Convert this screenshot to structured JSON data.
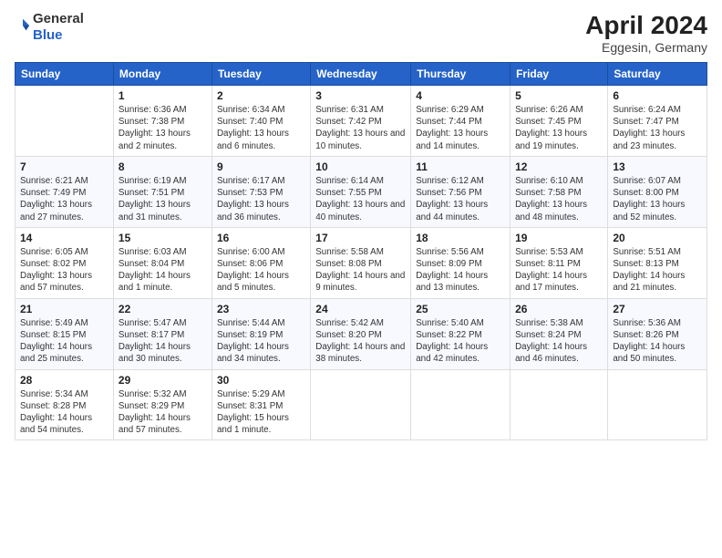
{
  "header": {
    "logo_general": "General",
    "logo_blue": "Blue",
    "month_year": "April 2024",
    "location": "Eggesin, Germany"
  },
  "weekdays": [
    "Sunday",
    "Monday",
    "Tuesday",
    "Wednesday",
    "Thursday",
    "Friday",
    "Saturday"
  ],
  "weeks": [
    [
      {
        "day": "",
        "sunrise": "",
        "sunset": "",
        "daylight": ""
      },
      {
        "day": "1",
        "sunrise": "Sunrise: 6:36 AM",
        "sunset": "Sunset: 7:38 PM",
        "daylight": "Daylight: 13 hours and 2 minutes."
      },
      {
        "day": "2",
        "sunrise": "Sunrise: 6:34 AM",
        "sunset": "Sunset: 7:40 PM",
        "daylight": "Daylight: 13 hours and 6 minutes."
      },
      {
        "day": "3",
        "sunrise": "Sunrise: 6:31 AM",
        "sunset": "Sunset: 7:42 PM",
        "daylight": "Daylight: 13 hours and 10 minutes."
      },
      {
        "day": "4",
        "sunrise": "Sunrise: 6:29 AM",
        "sunset": "Sunset: 7:44 PM",
        "daylight": "Daylight: 13 hours and 14 minutes."
      },
      {
        "day": "5",
        "sunrise": "Sunrise: 6:26 AM",
        "sunset": "Sunset: 7:45 PM",
        "daylight": "Daylight: 13 hours and 19 minutes."
      },
      {
        "day": "6",
        "sunrise": "Sunrise: 6:24 AM",
        "sunset": "Sunset: 7:47 PM",
        "daylight": "Daylight: 13 hours and 23 minutes."
      }
    ],
    [
      {
        "day": "7",
        "sunrise": "Sunrise: 6:21 AM",
        "sunset": "Sunset: 7:49 PM",
        "daylight": "Daylight: 13 hours and 27 minutes."
      },
      {
        "day": "8",
        "sunrise": "Sunrise: 6:19 AM",
        "sunset": "Sunset: 7:51 PM",
        "daylight": "Daylight: 13 hours and 31 minutes."
      },
      {
        "day": "9",
        "sunrise": "Sunrise: 6:17 AM",
        "sunset": "Sunset: 7:53 PM",
        "daylight": "Daylight: 13 hours and 36 minutes."
      },
      {
        "day": "10",
        "sunrise": "Sunrise: 6:14 AM",
        "sunset": "Sunset: 7:55 PM",
        "daylight": "Daylight: 13 hours and 40 minutes."
      },
      {
        "day": "11",
        "sunrise": "Sunrise: 6:12 AM",
        "sunset": "Sunset: 7:56 PM",
        "daylight": "Daylight: 13 hours and 44 minutes."
      },
      {
        "day": "12",
        "sunrise": "Sunrise: 6:10 AM",
        "sunset": "Sunset: 7:58 PM",
        "daylight": "Daylight: 13 hours and 48 minutes."
      },
      {
        "day": "13",
        "sunrise": "Sunrise: 6:07 AM",
        "sunset": "Sunset: 8:00 PM",
        "daylight": "Daylight: 13 hours and 52 minutes."
      }
    ],
    [
      {
        "day": "14",
        "sunrise": "Sunrise: 6:05 AM",
        "sunset": "Sunset: 8:02 PM",
        "daylight": "Daylight: 13 hours and 57 minutes."
      },
      {
        "day": "15",
        "sunrise": "Sunrise: 6:03 AM",
        "sunset": "Sunset: 8:04 PM",
        "daylight": "Daylight: 14 hours and 1 minute."
      },
      {
        "day": "16",
        "sunrise": "Sunrise: 6:00 AM",
        "sunset": "Sunset: 8:06 PM",
        "daylight": "Daylight: 14 hours and 5 minutes."
      },
      {
        "day": "17",
        "sunrise": "Sunrise: 5:58 AM",
        "sunset": "Sunset: 8:08 PM",
        "daylight": "Daylight: 14 hours and 9 minutes."
      },
      {
        "day": "18",
        "sunrise": "Sunrise: 5:56 AM",
        "sunset": "Sunset: 8:09 PM",
        "daylight": "Daylight: 14 hours and 13 minutes."
      },
      {
        "day": "19",
        "sunrise": "Sunrise: 5:53 AM",
        "sunset": "Sunset: 8:11 PM",
        "daylight": "Daylight: 14 hours and 17 minutes."
      },
      {
        "day": "20",
        "sunrise": "Sunrise: 5:51 AM",
        "sunset": "Sunset: 8:13 PM",
        "daylight": "Daylight: 14 hours and 21 minutes."
      }
    ],
    [
      {
        "day": "21",
        "sunrise": "Sunrise: 5:49 AM",
        "sunset": "Sunset: 8:15 PM",
        "daylight": "Daylight: 14 hours and 25 minutes."
      },
      {
        "day": "22",
        "sunrise": "Sunrise: 5:47 AM",
        "sunset": "Sunset: 8:17 PM",
        "daylight": "Daylight: 14 hours and 30 minutes."
      },
      {
        "day": "23",
        "sunrise": "Sunrise: 5:44 AM",
        "sunset": "Sunset: 8:19 PM",
        "daylight": "Daylight: 14 hours and 34 minutes."
      },
      {
        "day": "24",
        "sunrise": "Sunrise: 5:42 AM",
        "sunset": "Sunset: 8:20 PM",
        "daylight": "Daylight: 14 hours and 38 minutes."
      },
      {
        "day": "25",
        "sunrise": "Sunrise: 5:40 AM",
        "sunset": "Sunset: 8:22 PM",
        "daylight": "Daylight: 14 hours and 42 minutes."
      },
      {
        "day": "26",
        "sunrise": "Sunrise: 5:38 AM",
        "sunset": "Sunset: 8:24 PM",
        "daylight": "Daylight: 14 hours and 46 minutes."
      },
      {
        "day": "27",
        "sunrise": "Sunrise: 5:36 AM",
        "sunset": "Sunset: 8:26 PM",
        "daylight": "Daylight: 14 hours and 50 minutes."
      }
    ],
    [
      {
        "day": "28",
        "sunrise": "Sunrise: 5:34 AM",
        "sunset": "Sunset: 8:28 PM",
        "daylight": "Daylight: 14 hours and 54 minutes."
      },
      {
        "day": "29",
        "sunrise": "Sunrise: 5:32 AM",
        "sunset": "Sunset: 8:29 PM",
        "daylight": "Daylight: 14 hours and 57 minutes."
      },
      {
        "day": "30",
        "sunrise": "Sunrise: 5:29 AM",
        "sunset": "Sunset: 8:31 PM",
        "daylight": "Daylight: 15 hours and 1 minute."
      },
      {
        "day": "",
        "sunrise": "",
        "sunset": "",
        "daylight": ""
      },
      {
        "day": "",
        "sunrise": "",
        "sunset": "",
        "daylight": ""
      },
      {
        "day": "",
        "sunrise": "",
        "sunset": "",
        "daylight": ""
      },
      {
        "day": "",
        "sunrise": "",
        "sunset": "",
        "daylight": ""
      }
    ]
  ]
}
